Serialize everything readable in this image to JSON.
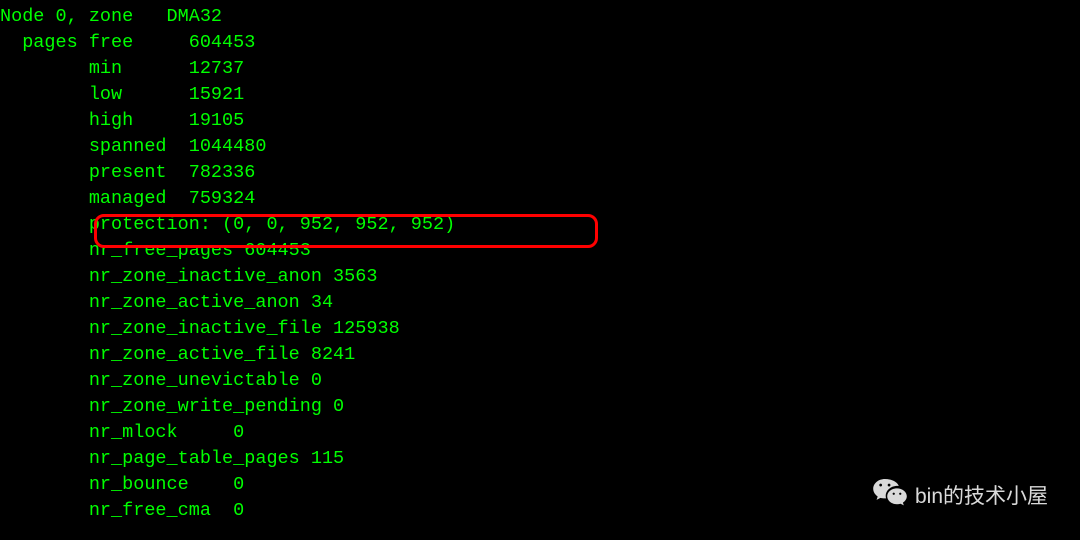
{
  "terminal": {
    "lines": [
      "Node 0, zone   DMA32",
      "  pages free     604453",
      "        min      12737",
      "        low      15921",
      "        high     19105",
      "        spanned  1044480",
      "        present  782336",
      "        managed  759324",
      "        protection: (0, 0, 952, 952, 952)",
      "        nr_free_pages 604453",
      "        nr_zone_inactive_anon 3563",
      "        nr_zone_active_anon 34",
      "        nr_zone_inactive_file 125938",
      "        nr_zone_active_file 8241",
      "        nr_zone_unevictable 0",
      "        nr_zone_write_pending 0",
      "        nr_mlock     0",
      "        nr_page_table_pages 115",
      "        nr_bounce    0",
      "        nr_free_cma  0"
    ]
  },
  "watermark": {
    "text": "bin的技术小屋"
  }
}
